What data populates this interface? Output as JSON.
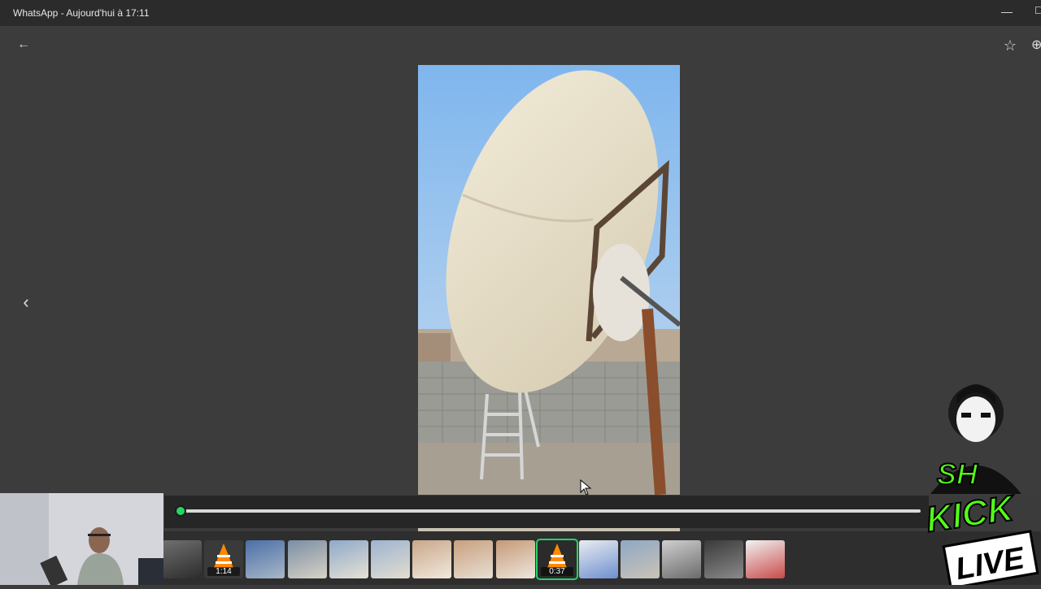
{
  "window": {
    "title": "WhatsApp - Aujourd'hui à 17:11",
    "minimize_label": "—",
    "maximize_label": "☐"
  },
  "toolbar": {
    "back_icon": "arrow-left-icon",
    "back_glyph": "←",
    "star_icon": "star-icon",
    "star_glyph": "☆",
    "more_icon": "more-icon",
    "more_glyph": "⊕",
    "prev_icon": "chevron-left-icon",
    "prev_glyph": "‹"
  },
  "player": {
    "progress": 0.0
  },
  "thumbnails": [
    {
      "kind": "image",
      "label": ""
    },
    {
      "kind": "video",
      "label": "1:14"
    },
    {
      "kind": "image",
      "label": ""
    },
    {
      "kind": "image",
      "label": ""
    },
    {
      "kind": "image",
      "label": ""
    },
    {
      "kind": "image",
      "label": ""
    },
    {
      "kind": "image",
      "label": ""
    },
    {
      "kind": "image",
      "label": ""
    },
    {
      "kind": "image",
      "label": ""
    },
    {
      "kind": "video",
      "label": "0:37",
      "selected": true
    },
    {
      "kind": "image",
      "label": ""
    },
    {
      "kind": "image",
      "label": ""
    },
    {
      "kind": "image",
      "label": ""
    },
    {
      "kind": "image",
      "label": ""
    },
    {
      "kind": "image",
      "label": ""
    }
  ],
  "stream_overlay": {
    "logo_text_1": "SH",
    "logo_text_2": "KICK",
    "logo_text_3": "LIVE"
  },
  "colors": {
    "accent": "#25d366",
    "titlebar": "#2b2b2b",
    "viewer_bg": "#3c3c3c"
  }
}
